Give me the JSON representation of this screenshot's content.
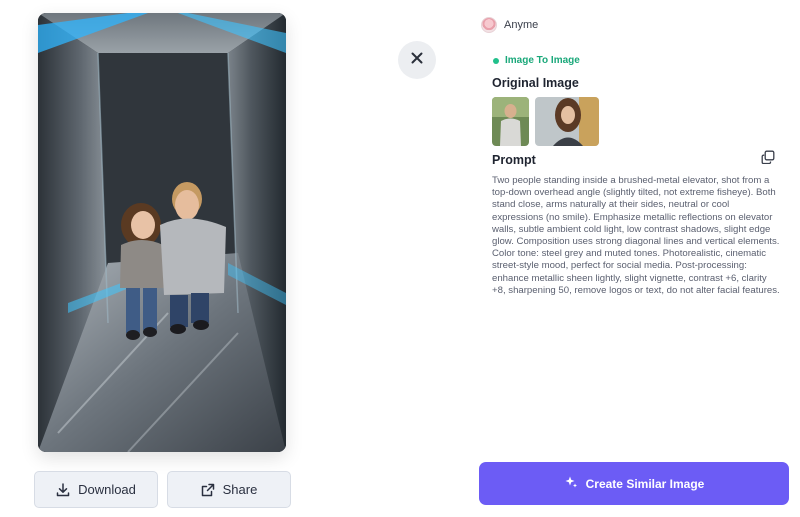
{
  "author": {
    "name": "Anyme"
  },
  "mode": {
    "label": "Image To Image",
    "color": "#21c08b"
  },
  "sections": {
    "original_title": "Original Image",
    "prompt_title": "Prompt"
  },
  "prompt": {
    "text": "Two people standing inside a brushed-metal elevator, shot from a top-down overhead angle (slightly tilted, not extreme fisheye). Both stand close, arms naturally at their sides, neutral or cool expressions (no smile). Emphasize metallic reflections on elevator walls, subtle ambient cold light, low contrast shadows, slight edge glow. Composition uses strong diagonal lines and vertical elements. Color tone: steel grey and muted tones. Photorealistic, cinematic street-style mood, perfect for social media. Post-processing: enhance metallic sheen lightly, slight vignette, contrast +6, clarity +8, sharpening 50, remove logos or text, do not alter facial features."
  },
  "actions": {
    "download": "Download",
    "share": "Share",
    "create": "Create Similar Image"
  },
  "colors": {
    "accent": "#6c5cf5",
    "button_bg": "#eef1f6",
    "close_bg": "#eceef1"
  },
  "icons": {
    "close": "close-icon",
    "download": "download-icon",
    "share": "share-icon",
    "copy": "copy-icon",
    "sparkle": "sparkle-icon"
  }
}
